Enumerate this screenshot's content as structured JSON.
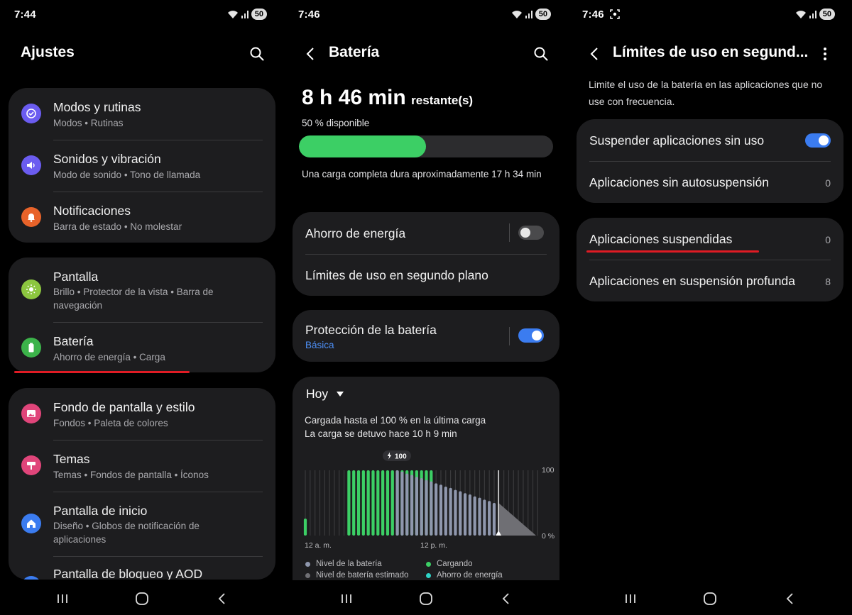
{
  "screen1": {
    "time": "7:44",
    "battery_badge": "50",
    "title": "Ajustes",
    "groups": [
      {
        "items": [
          {
            "title": "Modos y rutinas",
            "subtitle": "Modos  •  Rutinas",
            "icon": "check-circle-icon",
            "color": "#6b5cf0"
          },
          {
            "title": "Sonidos y vibración",
            "subtitle": "Modo de sonido  •  Tono de llamada",
            "icon": "speaker-icon",
            "color": "#6b5cf0"
          },
          {
            "title": "Notificaciones",
            "subtitle": "Barra de estado  •  No molestar",
            "icon": "bell-icon",
            "color": "#e8632a"
          }
        ]
      },
      {
        "items": [
          {
            "title": "Pantalla",
            "subtitle": "Brillo  •  Protector de la vista  •  Barra de navegación",
            "icon": "sun-icon",
            "color": "#8cc63f"
          },
          {
            "title": "Batería",
            "subtitle": "Ahorro de energía  •  Carga",
            "icon": "battery-icon",
            "color": "#3cb34a"
          }
        ]
      },
      {
        "items": [
          {
            "title": "Fondo de pantalla y estilo",
            "subtitle": "Fondos  •  Paleta de colores",
            "icon": "image-icon",
            "color": "#e0457a"
          },
          {
            "title": "Temas",
            "subtitle": "Temas  •  Fondos de pantalla  •  Íconos",
            "icon": "brush-icon",
            "color": "#e0457a"
          },
          {
            "title": "Pantalla de inicio",
            "subtitle": "Diseño  •  Globos de notificación de aplicaciones",
            "icon": "home-icon",
            "color": "#3b7cf0"
          },
          {
            "title": "Pantalla de bloqueo y AOD",
            "subtitle": "",
            "icon": "lock-icon",
            "color": "#3b7cf0"
          }
        ]
      }
    ]
  },
  "screen2": {
    "time": "7:46",
    "battery_badge": "50",
    "title": "Batería",
    "remaining_big": "8 h 46 min",
    "remaining_suffix": "restante(s)",
    "available": "50 % disponible",
    "level_percent": 50,
    "full_charge_text": "Una carga completa dura aproximadamente 17 h 34 min",
    "power_saving_label": "Ahorro de energía",
    "power_saving_on": false,
    "background_limits_label": "Límites de uso en segundo plano",
    "protection_label": "Protección de la batería",
    "protection_value": "Básica",
    "protection_on": true,
    "usage_period": "Hoy",
    "charged_line1": "Cargada hasta el 100 % en la última carga",
    "charged_line2": "La carga se detuvo hace 10 h 9 min"
  },
  "chart_data": {
    "type": "bar",
    "title": "",
    "xlabel": "",
    "ylabel": "",
    "ylim": [
      0,
      100
    ],
    "y_tick_labels": [
      "100",
      "0 %"
    ],
    "x_tick_labels": [
      "12 a. m.",
      "12 p. m."
    ],
    "peak_label": "100",
    "series": [
      {
        "name": "Cargando",
        "color": "#3ccf65",
        "values": [
          26,
          0,
          0,
          0,
          0,
          0,
          0,
          0,
          0,
          100,
          100,
          100,
          100,
          100,
          100,
          100,
          100,
          100,
          100,
          100,
          100,
          100,
          100,
          100,
          100,
          100,
          100
        ]
      },
      {
        "name": "Nivel de la batería",
        "color": "#8f97ad",
        "values": [
          0,
          0,
          0,
          0,
          0,
          0,
          0,
          0,
          0,
          0,
          0,
          0,
          0,
          0,
          0,
          0,
          0,
          0,
          0,
          100,
          98,
          95,
          93,
          90,
          88,
          85,
          83,
          80,
          78,
          75,
          73,
          70,
          68,
          65,
          63,
          60,
          58,
          55,
          53,
          50
        ]
      }
    ],
    "estimated_projection": {
      "name": "Nivel de batería estimado",
      "from": 50,
      "to": 0
    },
    "legend": [
      {
        "label": "Nivel de la batería",
        "color": "#8f97ad"
      },
      {
        "label": "Nivel de batería estimado",
        "color": "#6f6f74"
      },
      {
        "label": "Cargando",
        "color": "#3ccf65"
      },
      {
        "label": "Ahorro de energía",
        "color": "#2ed3c6"
      }
    ]
  },
  "screen3": {
    "time": "7:46",
    "battery_badge": "50",
    "title": "Límites de uso en segund...",
    "description": "Limite el uso de la batería en las aplicaciones que no use con frecuencia.",
    "sleep_unused_label": "Suspender aplicaciones sin uso",
    "sleep_unused_on": true,
    "never_sleeping_label": "Aplicaciones sin autosuspensión",
    "never_sleeping_count": "0",
    "sleeping_label": "Aplicaciones suspendidas",
    "sleeping_count": "0",
    "deep_sleeping_label": "Aplicaciones en suspensión profunda",
    "deep_sleeping_count": "8"
  }
}
